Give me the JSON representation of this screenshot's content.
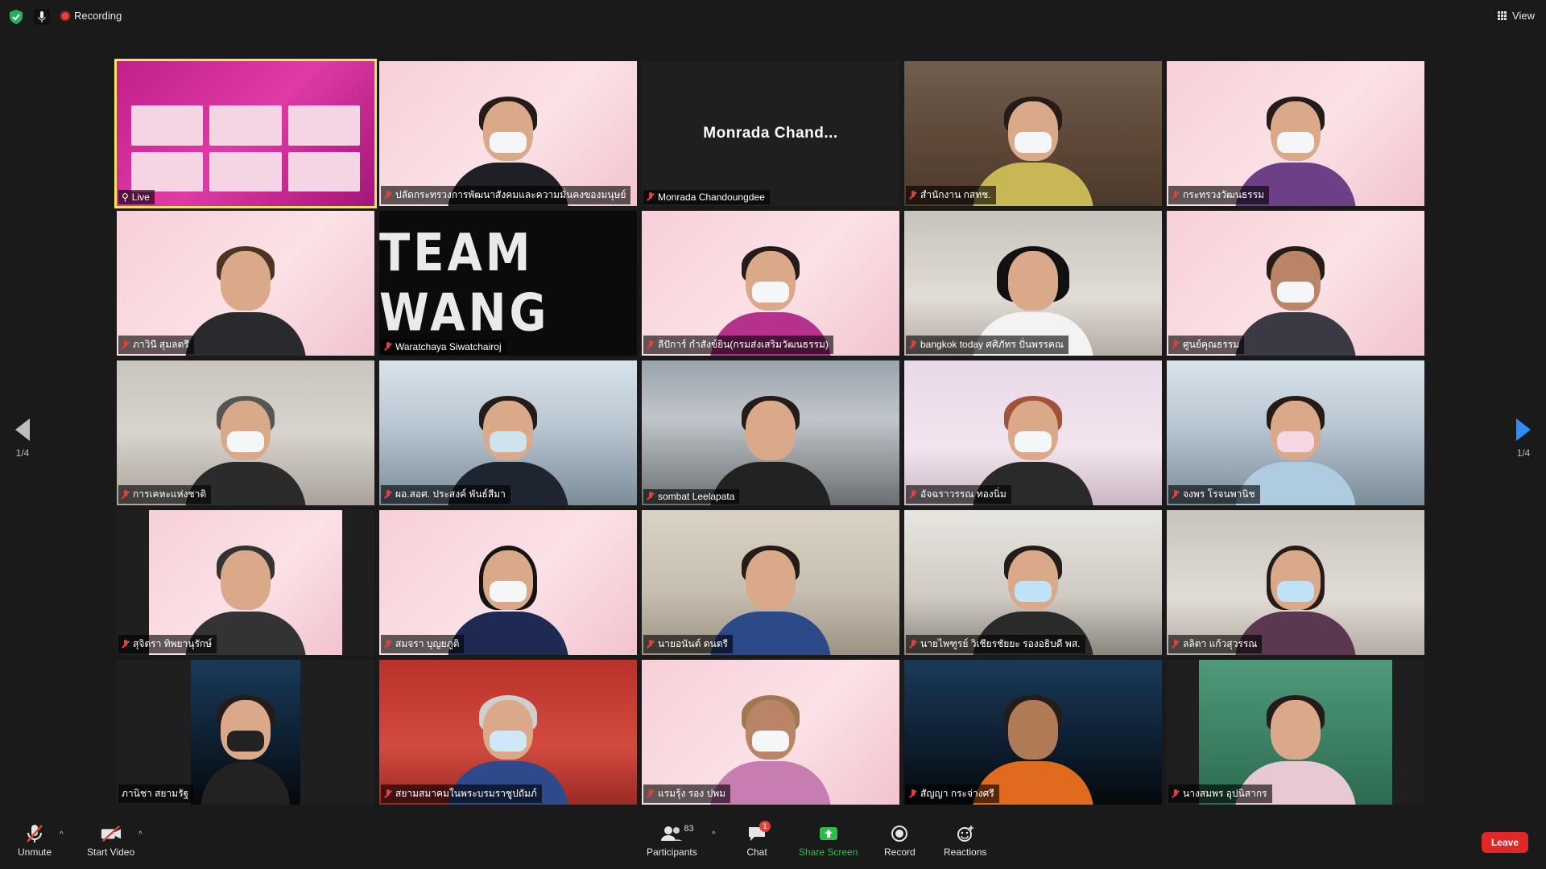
{
  "top_bar": {
    "recording_label": "Recording",
    "view_label": "View"
  },
  "pager": {
    "left_indicator": "1/4",
    "right_indicator": "1/4"
  },
  "tiles": [
    {
      "label": "Live",
      "muted": false,
      "kind": "live",
      "active": true
    },
    {
      "label": "ปลัดกระทรวงการพัฒนาสังคมและความมั่นคงของมนุษย์",
      "muted": true
    },
    {
      "label": "Monrada Chandoungdee",
      "display_name": "Monrada  Chand...",
      "muted": true,
      "kind": "name"
    },
    {
      "label": "สำนักงาน กสทช.",
      "muted": true
    },
    {
      "label": "กระทรวงวัฒนธรรม",
      "muted": true
    },
    {
      "label": "ภาวินี สุมลตรี",
      "muted": true
    },
    {
      "label": "Waratchaya Siwatchairoj",
      "muted": true,
      "kind": "wordmark",
      "wordmark": "TEAM WANG"
    },
    {
      "label": "ลีปัการ์ กำสังข์ยิน(กรมส่งเสริมวัฒนธรรม)",
      "muted": true
    },
    {
      "label": "bangkok today ศศิภัทร ปั่นพรรคณ",
      "muted": true
    },
    {
      "label": "ศูนย์คุณธรรม",
      "muted": true
    },
    {
      "label": "การเคหะแห่งชาติ",
      "muted": true
    },
    {
      "label": "ผอ.สอศ. ประสงค์ พันธ์สีมา",
      "muted": true
    },
    {
      "label": "sombat Leelapata",
      "muted": true
    },
    {
      "label": "อัจฉราวรรณ ทองนิ่ม",
      "muted": true
    },
    {
      "label": "จงพร โรจนพานิช",
      "muted": true
    },
    {
      "label": "สุจิตรา ทิพยานุรักษ์",
      "muted": true
    },
    {
      "label": "สมจรา บุญยภูติ",
      "muted": true
    },
    {
      "label": "นายอนันต์ ดนตรี",
      "muted": true
    },
    {
      "label": "นายไพฑูรย์ วิเชียรชัยยะ รองอธิบดี พส.",
      "muted": true
    },
    {
      "label": "ลลิตา แก้วสุวรรณ",
      "muted": true
    },
    {
      "label": "ภานิชา สยามรัฐ",
      "muted": false
    },
    {
      "label": "สยามสมาคมในพระบรมราชูปถัมภ์",
      "muted": true
    },
    {
      "label": "แรมรุ้ง รอง ปพม",
      "muted": true
    },
    {
      "label": "สัญญา กระจ่างศรี",
      "muted": true
    },
    {
      "label": "นางสมพร อุปนิสากร",
      "muted": true
    }
  ],
  "toolbar": {
    "unmute_label": "Unmute",
    "start_video_label": "Start Video",
    "participants_label": "Participants",
    "participants_count": "83",
    "chat_label": "Chat",
    "chat_badge": "1",
    "share_label": "Share Screen",
    "record_label": "Record",
    "reactions_label": "Reactions",
    "leave_label": "Leave"
  }
}
